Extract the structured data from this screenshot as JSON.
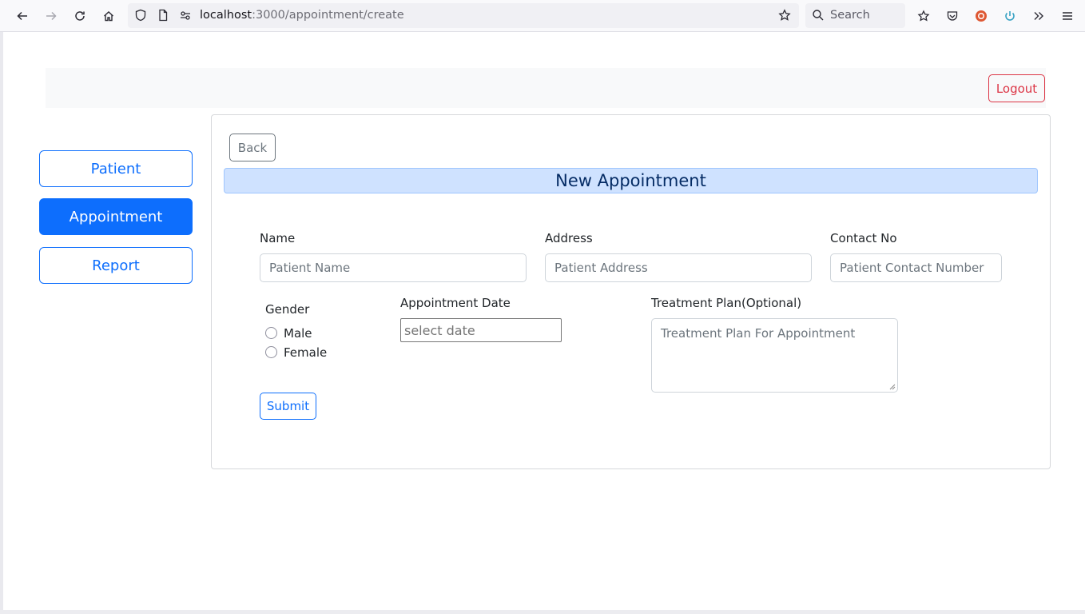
{
  "browser": {
    "url_host": "localhost",
    "url_path": ":3000/appointment/create",
    "search_label": "Search"
  },
  "navbar": {
    "logout_label": "Logout"
  },
  "sidebar": {
    "items": [
      {
        "label": "Patient",
        "active": false
      },
      {
        "label": "Appointment",
        "active": true
      },
      {
        "label": "Report",
        "active": false
      }
    ]
  },
  "form": {
    "back_label": "Back",
    "title": "New Appointment",
    "name": {
      "label": "Name",
      "placeholder": "Patient Name"
    },
    "address": {
      "label": "Address",
      "placeholder": "Patient Address"
    },
    "contact": {
      "label": "Contact No",
      "placeholder": "Patient Contact Number"
    },
    "gender": {
      "label": "Gender",
      "options": [
        "Male",
        "Female"
      ]
    },
    "date": {
      "label": "Appointment Date",
      "placeholder": "select date"
    },
    "treatment": {
      "label": "Treatment Plan(Optional)",
      "placeholder": "Treatment Plan For Appointment"
    },
    "submit_label": "Submit"
  },
  "colors": {
    "primary": "#0d6efd",
    "danger": "#dc3545",
    "secondary": "#6c757d",
    "title_bg": "#cfe2ff"
  }
}
